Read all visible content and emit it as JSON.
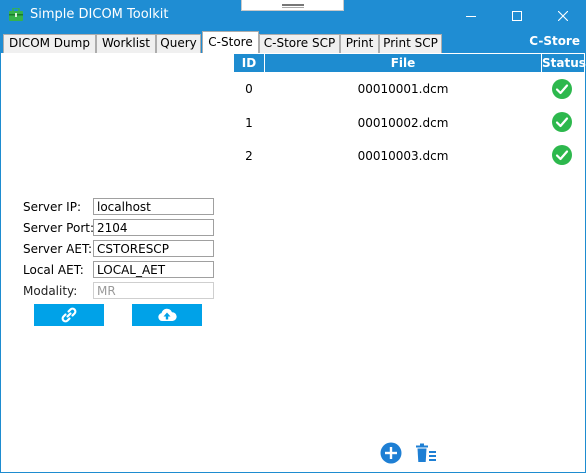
{
  "window": {
    "title": "Simple DICOM Toolkit",
    "icon": "toolbox-icon",
    "controls": [
      "minimize-icon",
      "maximize-icon",
      "close-icon"
    ]
  },
  "tabs": {
    "items": [
      {
        "label": "DICOM Dump"
      },
      {
        "label": "Worklist"
      },
      {
        "label": "Query"
      },
      {
        "label": "C-Store"
      },
      {
        "label": "C-Store SCP"
      },
      {
        "label": "Print"
      },
      {
        "label": "Print SCP"
      }
    ],
    "selected": "C-Store",
    "header_right": "C-Store"
  },
  "table": {
    "columns": [
      "ID",
      "File",
      "Status"
    ],
    "rows": [
      {
        "id": "0",
        "file": "00010001.dcm",
        "status": "success"
      },
      {
        "id": "1",
        "file": "00010002.dcm",
        "status": "success"
      },
      {
        "id": "2",
        "file": "00010003.dcm",
        "status": "success"
      }
    ]
  },
  "form": {
    "server_ip_label": "Server IP:",
    "server_ip_value": "localhost",
    "server_port_label": "Server Port:",
    "server_port_value": "2104",
    "server_aet_label": "Server  AET:",
    "server_aet_value": "CSTORESCP",
    "local_aet_label": "Local  AET:",
    "local_aet_value": "LOCAL_AET",
    "modality_label": "Modality:",
    "modality_value": "MR"
  },
  "actions": {
    "connect_icon": "link-icon",
    "upload_icon": "cloud-upload-icon",
    "add_icon": "plus-circle-icon",
    "clear_icon": "trash-list-icon"
  },
  "colors": {
    "accent": "#1e8cd0",
    "button": "#00a2e8",
    "success": "#2db84d"
  }
}
